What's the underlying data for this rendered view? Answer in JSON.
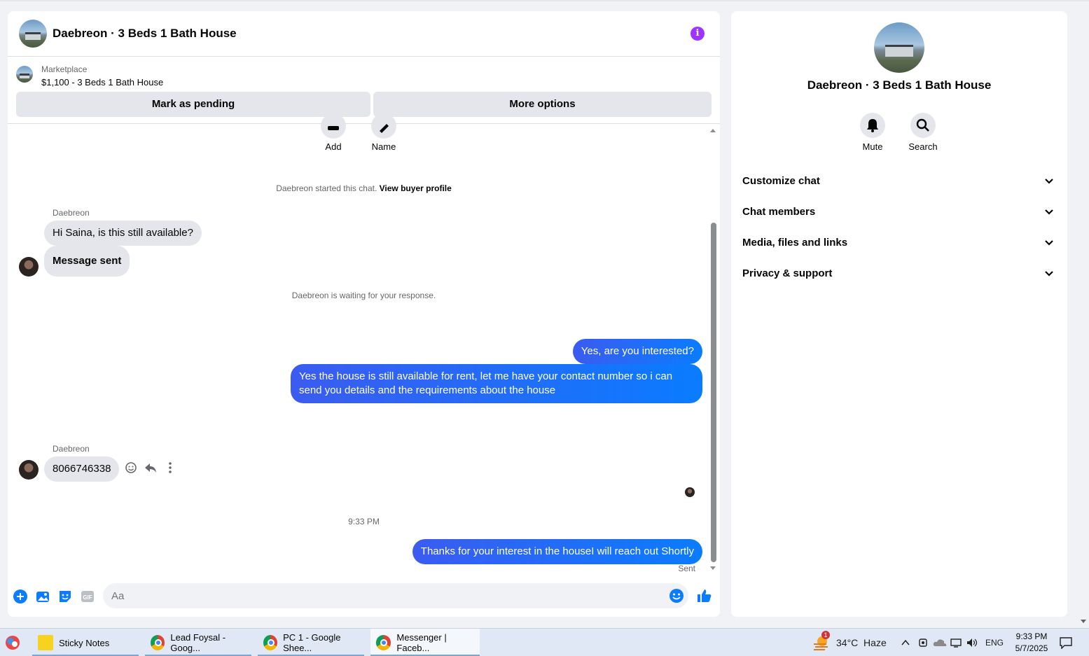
{
  "chat": {
    "title": "Daebreon · 3 Beds 1 Bath House",
    "listing": {
      "label": "Marketplace",
      "price_title": "$1,100 - 3 Beds 1 Bath House"
    },
    "buttons": {
      "pending": "Mark as pending",
      "more": "More options"
    },
    "quick_actions": {
      "add": "Add",
      "name": "Name"
    },
    "started_text": "Daebreon started this chat.",
    "view_profile": "View buyer profile",
    "sender_name": "Daebreon",
    "msg1": "Hi Saina, is this still available?",
    "msg2": "Message sent",
    "waiting_text": "Daebreon is waiting for your response.",
    "out1": "Yes, are you interested?",
    "out2": "Yes the house is still available for rent, let me have your contact number so i can send you details and the requirements about the house",
    "sender_name2": "Daebreon",
    "msg3": "8066746338",
    "timestamp": "9:33 PM",
    "out3": "Thanks for your interest in the houseI will reach out Shortly",
    "status": "Sent",
    "composer_placeholder": "Aa"
  },
  "info_panel": {
    "title": "Daebreon · 3 Beds 1 Bath House",
    "mute": "Mute",
    "search": "Search",
    "sections": [
      "Customize chat",
      "Chat members",
      "Media, files and links",
      "Privacy & support"
    ]
  },
  "taskbar": {
    "items": [
      "Sticky Notes",
      "Lead Foysal - Goog...",
      "PC 1 - Google Shee...",
      "Messenger | Faceb..."
    ],
    "weather": "34°C  Haze",
    "weather_badge": "1",
    "lang": "ENG",
    "time": "9:33 PM",
    "date": "5/7/2025"
  },
  "colors": {
    "accent": "#0a7cff",
    "info": "#a033ff"
  }
}
